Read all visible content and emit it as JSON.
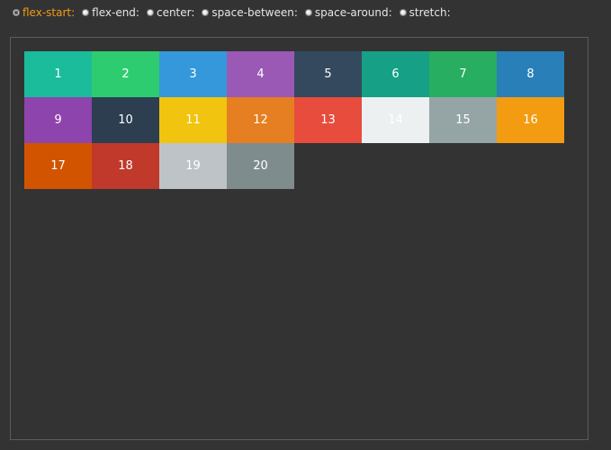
{
  "options": [
    {
      "label": "flex-start:",
      "selected": true
    },
    {
      "label": "flex-end:",
      "selected": false
    },
    {
      "label": "center:",
      "selected": false
    },
    {
      "label": "space-between:",
      "selected": false
    },
    {
      "label": "space-around:",
      "selected": false
    },
    {
      "label": "stretch:",
      "selected": false
    }
  ],
  "accent_color": "#f39c12",
  "boxes": [
    {
      "label": "1",
      "color": "#1abc9c"
    },
    {
      "label": "2",
      "color": "#2ecc71"
    },
    {
      "label": "3",
      "color": "#3498db"
    },
    {
      "label": "4",
      "color": "#9b59b6"
    },
    {
      "label": "5",
      "color": "#34495e"
    },
    {
      "label": "6",
      "color": "#16a085"
    },
    {
      "label": "7",
      "color": "#27ae60"
    },
    {
      "label": "8",
      "color": "#2980b9"
    },
    {
      "label": "9",
      "color": "#8e44ad"
    },
    {
      "label": "10",
      "color": "#2c3e50"
    },
    {
      "label": "11",
      "color": "#f1c40f"
    },
    {
      "label": "12",
      "color": "#e67e22"
    },
    {
      "label": "13",
      "color": "#e74c3c"
    },
    {
      "label": "14",
      "color": "#ecf0f1"
    },
    {
      "label": "15",
      "color": "#95a5a6"
    },
    {
      "label": "16",
      "color": "#f39c12"
    },
    {
      "label": "17",
      "color": "#d35400"
    },
    {
      "label": "18",
      "color": "#c0392b"
    },
    {
      "label": "19",
      "color": "#bdc3c7"
    },
    {
      "label": "20",
      "color": "#7f8c8d"
    }
  ]
}
